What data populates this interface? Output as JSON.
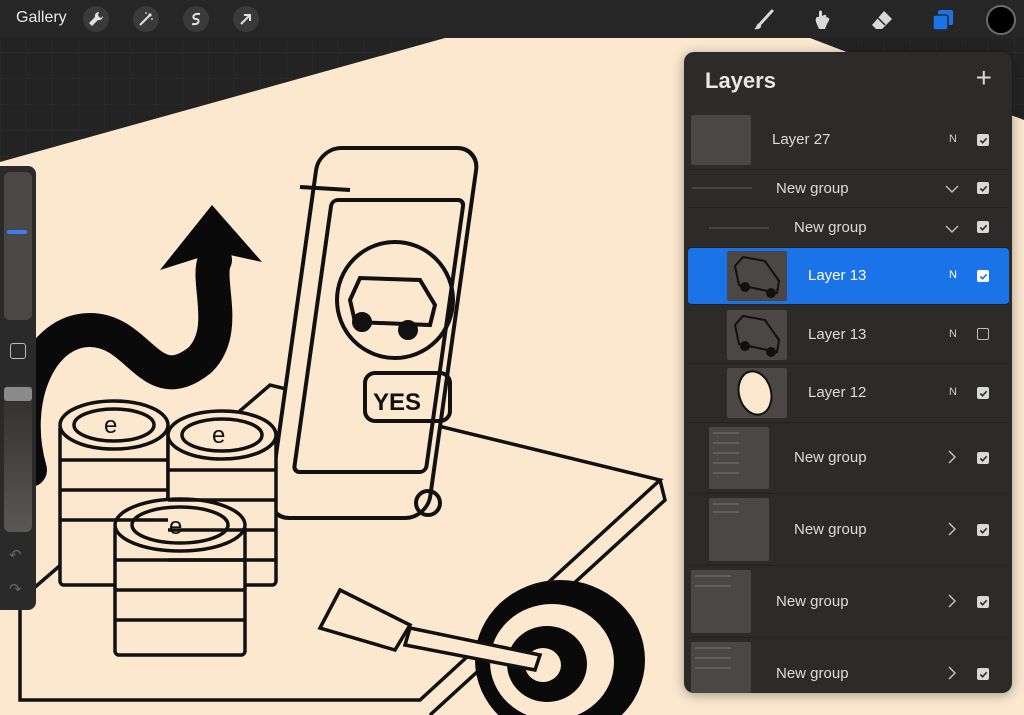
{
  "topbar": {
    "gallery_label": "Gallery",
    "left_tools": [
      "wrench-icon",
      "magic-wand-icon",
      "selection-icon",
      "transform-arrow-icon"
    ],
    "right_tools": [
      "brush-icon",
      "smudge-icon",
      "eraser-icon",
      "layers-icon"
    ],
    "layers_icon_color": "#1a74e8",
    "current_color": "#000000"
  },
  "canvas": {
    "paper_color": "#fbe8cf",
    "phone_label": "YES",
    "coin_symbol": "e"
  },
  "layers_panel": {
    "title": "Layers",
    "add_button": "+",
    "accent_color": "#1a74e8",
    "rows": [
      {
        "kind": "layer",
        "label": "Layer 27",
        "blend": "N",
        "visible": true
      },
      {
        "kind": "group",
        "label": "New group",
        "expanded": true,
        "visible": true
      },
      {
        "kind": "group",
        "label": "New group",
        "expanded": true,
        "visible": true
      },
      {
        "kind": "layer",
        "label": "Layer 13",
        "blend": "N",
        "visible": true,
        "selected": true
      },
      {
        "kind": "layer",
        "label": "Layer 13",
        "blend": "N",
        "visible": false
      },
      {
        "kind": "layer",
        "label": "Layer 12",
        "blend": "N",
        "visible": true
      },
      {
        "kind": "group",
        "label": "New group",
        "expanded": false,
        "visible": true
      },
      {
        "kind": "group",
        "label": "New group",
        "expanded": false,
        "visible": true
      },
      {
        "kind": "group",
        "label": "New group",
        "expanded": false,
        "visible": true
      },
      {
        "kind": "group",
        "label": "New group",
        "expanded": false,
        "visible": true
      }
    ]
  }
}
